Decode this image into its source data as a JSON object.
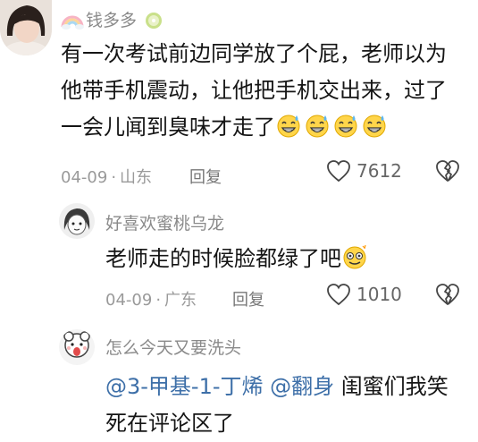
{
  "comments": [
    {
      "username": "钱多多",
      "text_lines": [
        "有一次考试前边同学放了个屁，老师以为",
        "他带手机震动，让他把手机交出来，过了",
        "一会儿闻到臭味才走了"
      ],
      "date": "04-09",
      "location": "山东",
      "reply_label": "回复",
      "likes": "7612",
      "emoji_trailing": "grinning-sweat-emoji x4"
    },
    {
      "username": "好喜欢蜜桃乌龙",
      "text": "老师走的时候脸都绿了吧",
      "date": "04-09",
      "location": "广东",
      "reply_label": "回复",
      "likes": "1010",
      "emoji_trailing": "dizzy-smile-emoji"
    },
    {
      "username": "怎么今天又要洗头",
      "mention1": "@3-甲基-1-丁烯",
      "mention2": "@翻身",
      "text_after": " 闺蜜们我笑",
      "text_line2": "死在评论区了"
    }
  ],
  "meta_separator": "·",
  "colors": {
    "mention": "#3d6fa8",
    "secondary": "#9a9a9a"
  }
}
